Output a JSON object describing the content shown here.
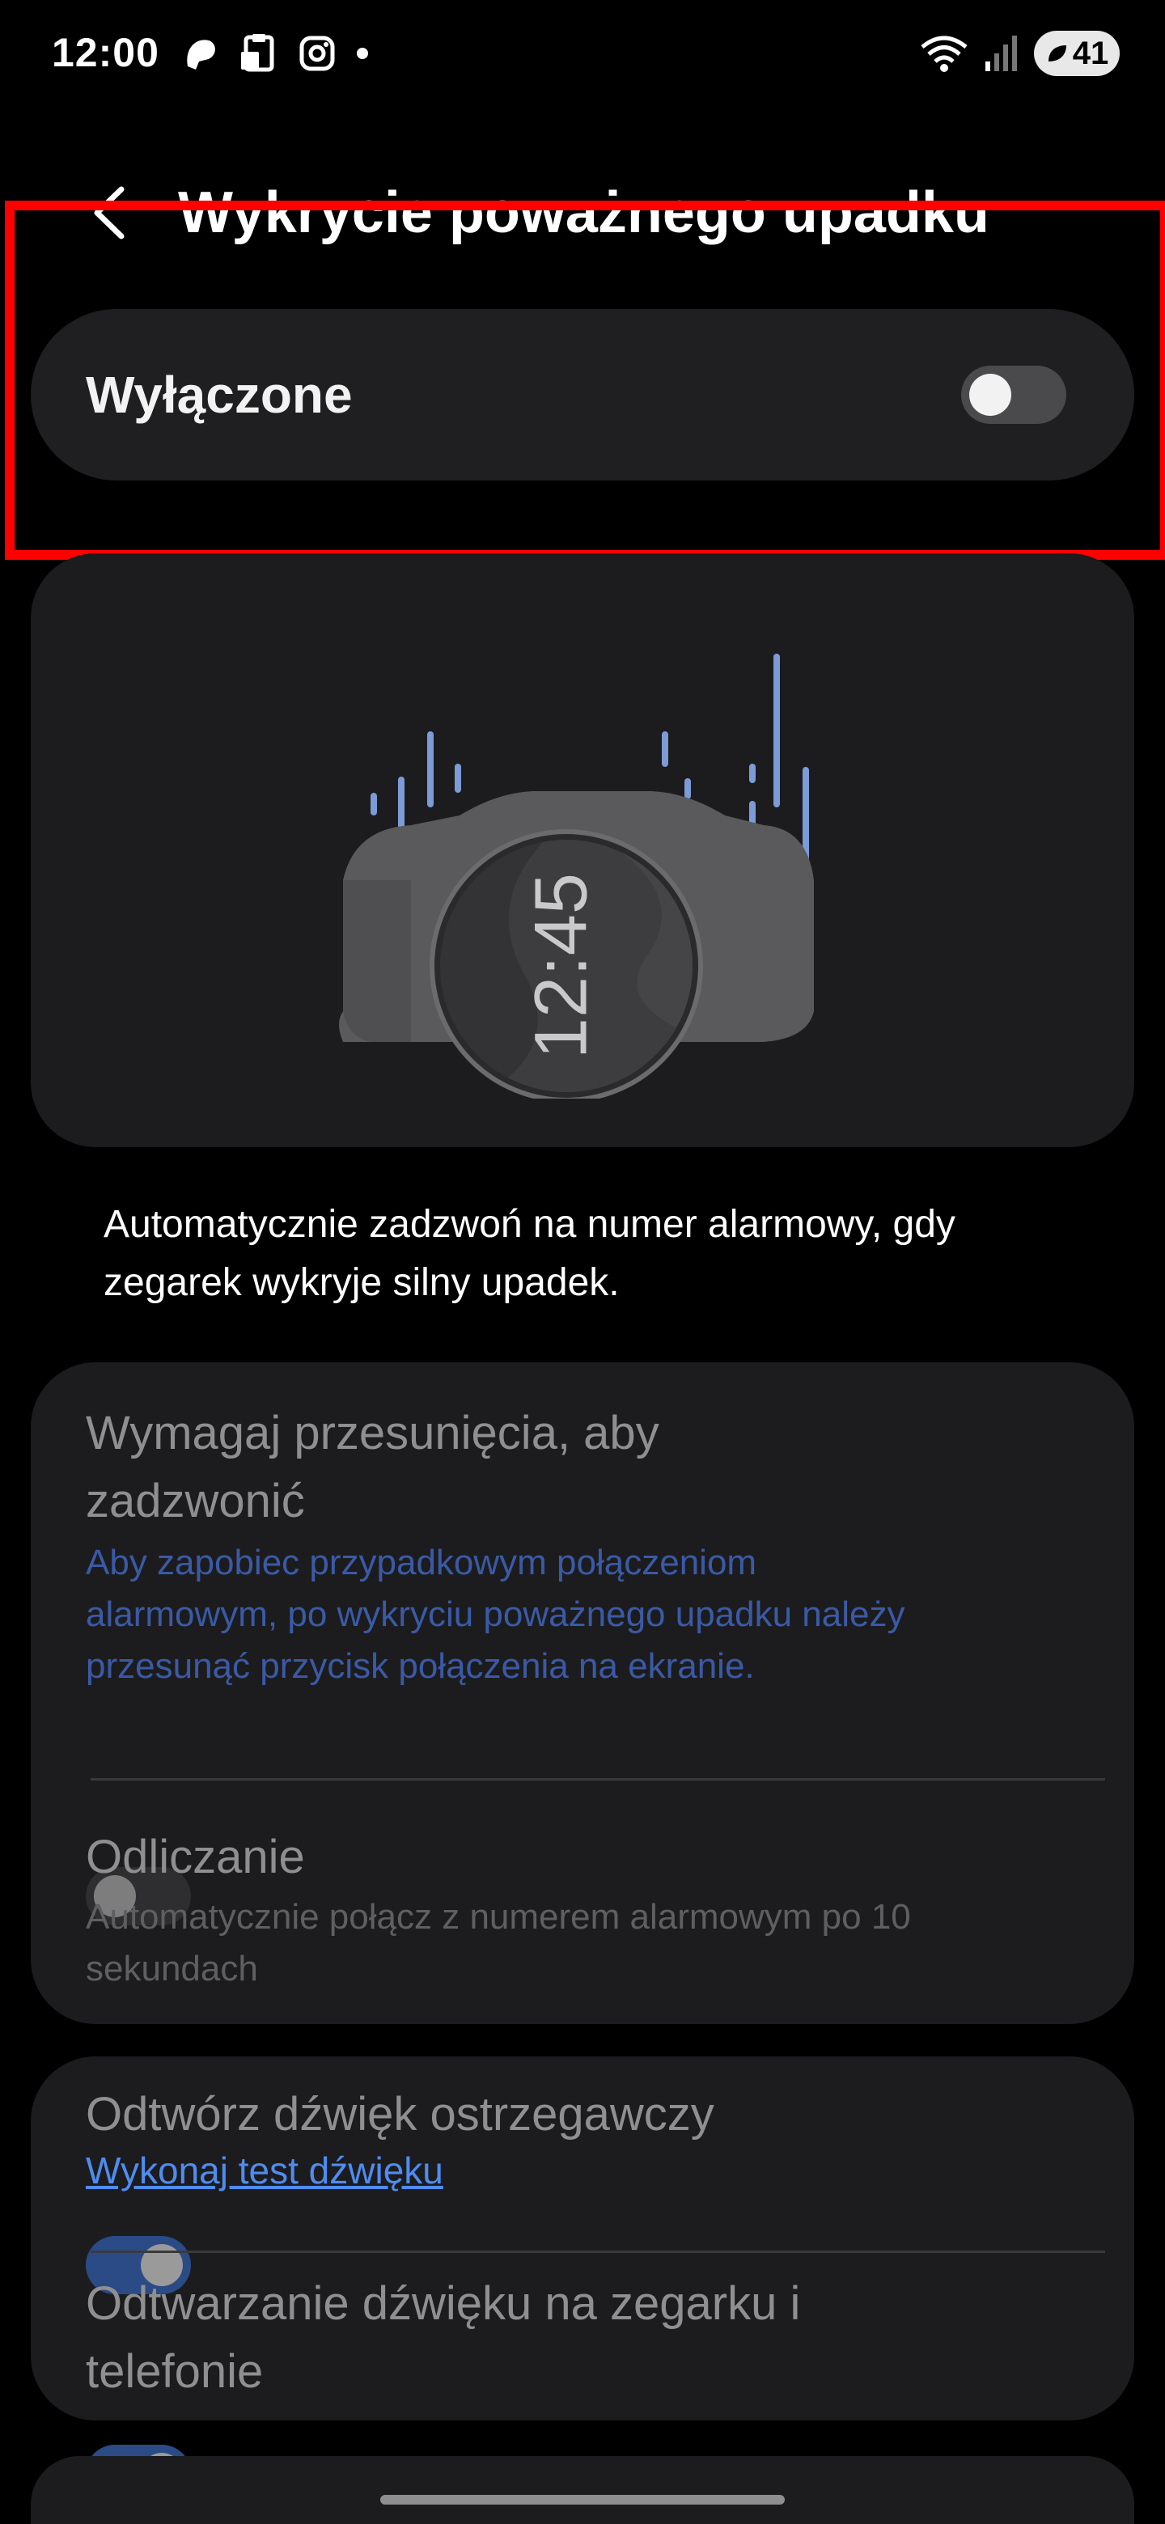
{
  "status_bar": {
    "time": "12:00",
    "battery": "41",
    "icons_left": [
      "app-icon",
      "clipboard-icon",
      "instagram-icon",
      "dot-icon"
    ],
    "icons_right": [
      "wifi-icon",
      "signal-icon",
      "battery-icon"
    ]
  },
  "header": {
    "title": "Wykrycie poważnego upadku"
  },
  "master_toggle": {
    "label": "Wyłączone",
    "state": "off"
  },
  "illustration": {
    "watch_time": "12:45"
  },
  "description": "Automatycznie zadzwoń na numer alarmowy, gdy zegarek wykryje silny upadek.",
  "group1": {
    "swipe": {
      "title": "Wymagaj przesunięcia, aby zadzwonić",
      "subtitle": "Aby zapobiec przypadkowym połączeniom alarmowym, po wykryciu poważnego upadku należy przesunąć przycisk połączenia na ekranie.",
      "state": "off"
    },
    "countdown": {
      "title": "Odliczanie",
      "subtitle": "Automatycznie połącz z numerem alarmowym po 10 sekundach"
    }
  },
  "group2": {
    "warning_sound": {
      "title": "Odtwórz dźwięk ostrzegawczy",
      "link": "Wykonaj test dźwięku",
      "state": "on"
    },
    "watch_phone_sound": {
      "title": "Odtwarzanie dźwięku na zegarku i telefonie",
      "state": "on"
    }
  },
  "colors": {
    "background": "#000000",
    "card": "#1c1c1e",
    "accent_blue": "#2b4b86",
    "link_blue": "#4f8cf0",
    "highlight_red": "#ff0000"
  }
}
